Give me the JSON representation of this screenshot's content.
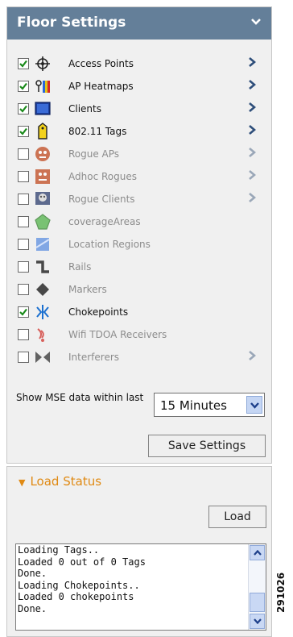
{
  "floor_settings": {
    "title": "Floor Settings",
    "header_color": "#647f99"
  },
  "layers": [
    {
      "label": "Access Points",
      "checked": true,
      "has_arrow": true,
      "icon": "access-point-icon"
    },
    {
      "label": "AP Heatmaps",
      "checked": true,
      "has_arrow": true,
      "icon": "heatmap-icon"
    },
    {
      "label": "Clients",
      "checked": true,
      "has_arrow": true,
      "icon": "client-icon"
    },
    {
      "label": "802.11 Tags",
      "checked": true,
      "has_arrow": true,
      "icon": "tag-icon"
    },
    {
      "label": "Rogue APs",
      "checked": false,
      "has_arrow": true,
      "icon": "rogue-ap-icon"
    },
    {
      "label": "Adhoc Rogues",
      "checked": false,
      "has_arrow": true,
      "icon": "adhoc-rogue-icon"
    },
    {
      "label": "Rogue Clients",
      "checked": false,
      "has_arrow": true,
      "icon": "rogue-client-icon"
    },
    {
      "label": "coverageAreas",
      "checked": false,
      "has_arrow": false,
      "icon": "coverage-area-icon"
    },
    {
      "label": "Location Regions",
      "checked": false,
      "has_arrow": false,
      "icon": "location-region-icon"
    },
    {
      "label": "Rails",
      "checked": false,
      "has_arrow": false,
      "icon": "rail-icon"
    },
    {
      "label": "Markers",
      "checked": false,
      "has_arrow": false,
      "icon": "marker-icon"
    },
    {
      "label": "Chokepoints",
      "checked": true,
      "has_arrow": false,
      "icon": "chokepoint-icon"
    },
    {
      "label": "Wifi TDOA Receivers",
      "checked": false,
      "has_arrow": false,
      "icon": "wifi-tdoa-receiver-icon"
    },
    {
      "label": "Interferers",
      "checked": false,
      "has_arrow": true,
      "icon": "interferer-icon"
    }
  ],
  "mse": {
    "label": "Show MSE data within last",
    "selected": "15 Minutes"
  },
  "save_button_label": "Save Settings",
  "load_status": {
    "title": "Load Status",
    "load_button_label": "Load",
    "log_lines": [
      "Loading Tags..",
      "Loaded 0 out of 0 Tags",
      "Done.",
      "Loading Chokepoints..",
      "Loaded 0 chokepoints",
      "Done."
    ]
  },
  "figure_id": "291026",
  "colors": {
    "accent_orange": "#e08a14",
    "arrow_blue": "#2e4e7a",
    "checkmark_green": "#1a8a1a"
  }
}
